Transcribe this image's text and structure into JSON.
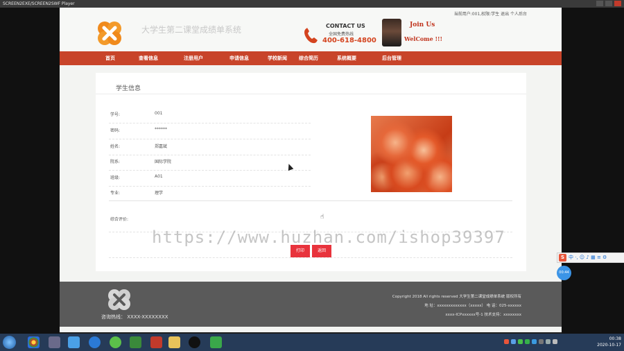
{
  "window": {
    "title": "SCREEN2EXE/SCREEN2SWF Player"
  },
  "header": {
    "site_title": "大学生第二课堂成绩单系统",
    "contact_title": "CONTACT US",
    "contact_sub": "全国免费热线",
    "contact_phone": "400-618-4800",
    "join_line1": "Join Us",
    "join_line2": "WelCome !!!",
    "user_info": "当前用户:001,权限:学生 退出 个人后台"
  },
  "nav": {
    "items": [
      "首页",
      "查看信息",
      "注册用户",
      "申请信息",
      "学校新闻",
      "综合简历",
      "系统概要",
      "后台管理"
    ]
  },
  "profile": {
    "section_title": "学生信息",
    "fields": [
      {
        "label": "学号:",
        "value": "001"
      },
      {
        "label": "密码:",
        "value": "******"
      },
      {
        "label": "姓名:",
        "value": "郑嘉斌"
      },
      {
        "label": "院系:",
        "value": "国际学院"
      },
      {
        "label": "班级:",
        "value": "A01"
      },
      {
        "label": "专业:",
        "value": "理学"
      }
    ],
    "evaluation_label": "综合评价:"
  },
  "actions": {
    "print_label": "打印",
    "back_label": "返回"
  },
  "watermark": "https://www.huzhan.com/ishop39397",
  "footer": {
    "hotline": "咨询热线：  XXXX-XXXXXXXX",
    "copyright": "Copyright 2018 All rights reserved 大学生第二课堂成绩单系统 版权所有",
    "address": "地  址：xxxxxxxxxxxxx（xxxxx）  电  话：025-xxxxxx",
    "icp": "xxxx-ICPxxxxxx号-1 技术支持：xxxxxxxx"
  },
  "taskbar": {
    "time": "00:38",
    "date": "2020-10-17"
  },
  "ime": {
    "label": "中 ·, ☺ ♪ ▦ ≡ ⚙"
  },
  "bubble": {
    "label": "00:44"
  },
  "colors": {
    "nav": "#c8442a",
    "accent": "#d4441f",
    "button": "#e8333c",
    "footer": "#5a5a5a"
  }
}
